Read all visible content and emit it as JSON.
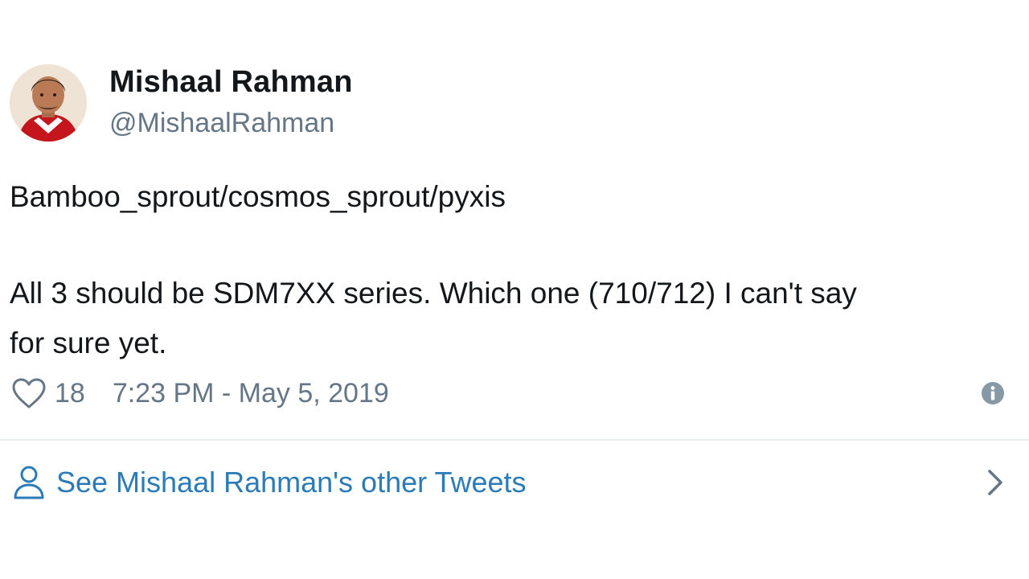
{
  "author": {
    "display_name": "Mishaal Rahman",
    "handle": "@MishaalRahman"
  },
  "tweet": {
    "lines": [
      "Bamboo_sprout/cosmos_sprout/pyxis",
      "All 3 should be SDM7XX series. Which one (710/712) I can't say",
      "for sure yet."
    ],
    "like_count": "18",
    "timestamp": "7:23 PM - May 5, 2019"
  },
  "footer": {
    "other_tweets_label": "See Mishaal Rahman's other Tweets"
  },
  "icons": {
    "like": "heart-icon",
    "info": "info-icon",
    "profile": "person-icon",
    "more": "chevron-right-icon"
  },
  "colors": {
    "link": "#2b7bb9",
    "muted": "#657786",
    "text": "#14171a",
    "divider": "#e6ecf0"
  }
}
